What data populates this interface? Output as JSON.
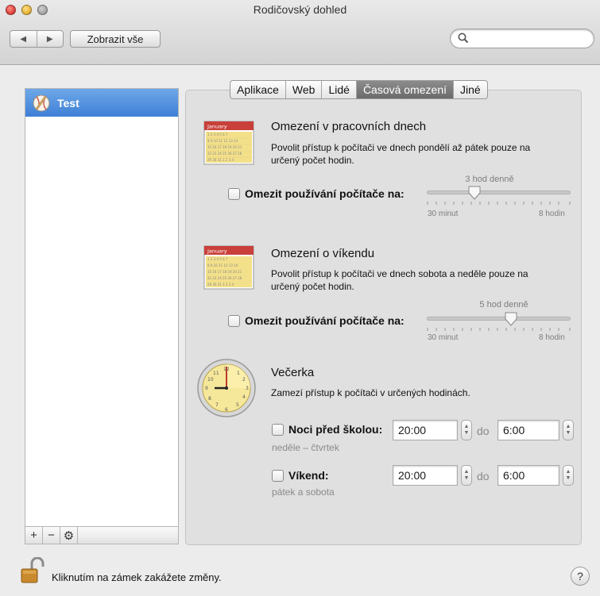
{
  "window": {
    "title": "Rodičovský dohled"
  },
  "toolbar": {
    "back": "◀",
    "forward": "▶",
    "show_all": "Zobrazit vše",
    "search_placeholder": ""
  },
  "users": [
    {
      "name": "Test"
    }
  ],
  "list_controls": {
    "add": "+",
    "remove": "−",
    "action": "⚙"
  },
  "tabs": [
    {
      "label": "Aplikace",
      "selected": false
    },
    {
      "label": "Web",
      "selected": false
    },
    {
      "label": "Lidé",
      "selected": false
    },
    {
      "label": "Časová omezení",
      "selected": true
    },
    {
      "label": "Jiné",
      "selected": false
    }
  ],
  "weekdays": {
    "title": "Omezení v pracovních dnech",
    "desc_line1": "Povolit přístup k počítači ve dnech pondělí až pátek pouze na",
    "desc_line2": "určený počet hodin.",
    "limit_label": "Omezit používání počítače na:",
    "value_label": "3 hod denně",
    "value_hours": 3,
    "min_label": "30 minut",
    "max_label": "8 hodin",
    "calendar_month": "January",
    "checked": false
  },
  "weekend": {
    "title": "Omezení o víkendu",
    "desc_line1": "Povolit přístup k počítači ve dnech sobota a neděle pouze na",
    "desc_line2": "určený počet hodin.",
    "limit_label": "Omezit používání počítače na:",
    "value_label": "5 hod denně",
    "value_hours": 5,
    "min_label": "30 minut",
    "max_label": "8 hodin",
    "calendar_month": "January",
    "checked": false
  },
  "bedtime": {
    "title": "Večerka",
    "desc": "Zamezí přístup k počítači v určených hodinách.",
    "school_nights": {
      "label": "Noci před školou:",
      "sub": "neděle – čtvrtek",
      "from": "20:00",
      "to": "6:00",
      "checked": false
    },
    "weekend": {
      "label": "Víkend:",
      "sub": "pátek a sobota",
      "from": "20:00",
      "to": "6:00",
      "checked": false
    },
    "to_word": "do"
  },
  "footer": {
    "lock_text": "Kliknutím na zámek zakážete změny.",
    "help": "?"
  },
  "colors": {
    "selection": "#4a8ad9",
    "selected_tab": "#7a7a7a"
  }
}
